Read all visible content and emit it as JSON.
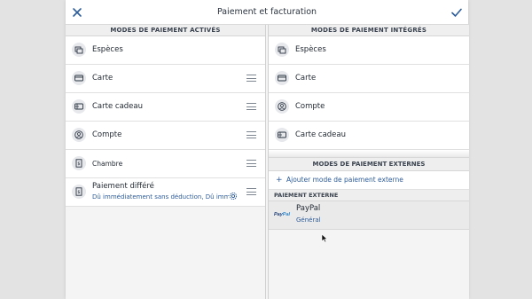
{
  "header": {
    "title": "Paiement et facturation"
  },
  "left": {
    "title": "MODES DE PAIEMENT ACTIVÉS",
    "items": [
      {
        "label": "Espèces"
      },
      {
        "label": "Carte"
      },
      {
        "label": "Carte cadeau"
      },
      {
        "label": "Compte"
      },
      {
        "label": "Chambre"
      },
      {
        "label": "Paiement différé",
        "sub": "Dû immédiatement sans déduction, Dû immé..."
      }
    ]
  },
  "right": {
    "title": "MODES DE PAIEMENT INTÉGRÉS",
    "items": [
      {
        "label": "Espèces"
      },
      {
        "label": "Carte"
      },
      {
        "label": "Compte"
      },
      {
        "label": "Carte cadeau"
      }
    ],
    "external": {
      "title": "MODES DE PAIEMENT EXTERNES",
      "add_label": "Ajouter mode de paiement externe",
      "add_symbol": "+",
      "subsection": "PAIEMENT EXTERNE",
      "paypal": {
        "logo_a": "Pay",
        "logo_b": "Pal",
        "name": "PayPal",
        "sub": "Général"
      }
    }
  },
  "icons": {
    "close": "close-icon",
    "confirm": "checkmark-icon",
    "accent": "#2d5c9a"
  }
}
